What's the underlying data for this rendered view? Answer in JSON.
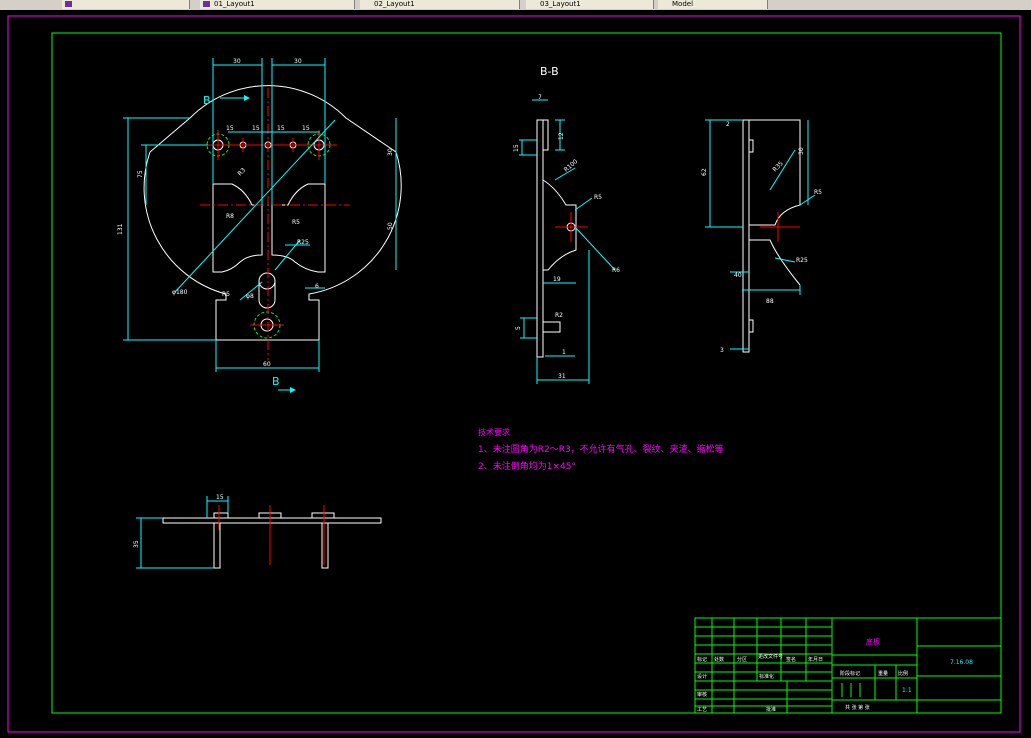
{
  "tabs": [
    {
      "label": ""
    },
    {
      "label": "01_Layout1"
    },
    {
      "label": "02_Layout1"
    },
    {
      "label": "03_Layout1"
    },
    {
      "label": "Model"
    }
  ],
  "drawing": {
    "section_label": "B-B",
    "cut_mark_top": "B",
    "cut_mark_bottom": "B",
    "dims_front": {
      "w30a": "30",
      "w30b": "30",
      "s15a": "15",
      "s15b": "15",
      "s15c": "15",
      "s15d": "15",
      "h131": "131",
      "h75": "75",
      "h30": "30",
      "h50": "50",
      "r8a": "R8",
      "r5a": "R5",
      "r25": "R25",
      "r5b": "R5",
      "d8": "φ8",
      "dia180": "φ180",
      "r3": "R3",
      "w60": "60",
      "d6": "6",
      "r6": "R6"
    },
    "dims_section": {
      "d7": "7",
      "d12": "12",
      "d15": "15",
      "r5": "R5",
      "r2": "R2",
      "d19": "19",
      "d31": "31",
      "d1": "1",
      "d5": "5",
      "r6": "R6",
      "r100": "R100"
    },
    "dims_side": {
      "d2": "2",
      "d62": "62",
      "d30": "30",
      "r5": "R5",
      "r35": "R35",
      "d88": "88",
      "d3": "3",
      "d40": "40",
      "r25": "R25"
    },
    "dims_bottom": {
      "d15": "15",
      "d35": "35"
    },
    "tech_req": {
      "title": "技术要求",
      "line1": "1、未注圆角为R2～R3，不允许有气孔、裂纹、夹渣、缩松等",
      "line2": "2、未注倒角均为1×45°"
    },
    "title_block": {
      "part_name": "底板",
      "drawing_no": "7.16.08",
      "scale": "1:1",
      "material_label": "阶段标记",
      "weight_label": "重量",
      "scale_label": "比例",
      "sheet_label": "共 张 第 张",
      "row_labels": [
        "标记",
        "处数",
        "分区",
        "更改文件号",
        "签名",
        "年月日"
      ],
      "design_label": "设计",
      "std_label": "标准化",
      "check_label": "审核",
      "process_label": "工艺",
      "approve_label": "批准"
    }
  },
  "colors": {
    "border_outer": "#ff00ff",
    "border_inner": "#00ff00",
    "geometry": "#ffffff",
    "dimension": "#00ffff",
    "center": "#ff0000",
    "hole_ring": "#00ff00",
    "text_magenta": "#ff00ff"
  }
}
